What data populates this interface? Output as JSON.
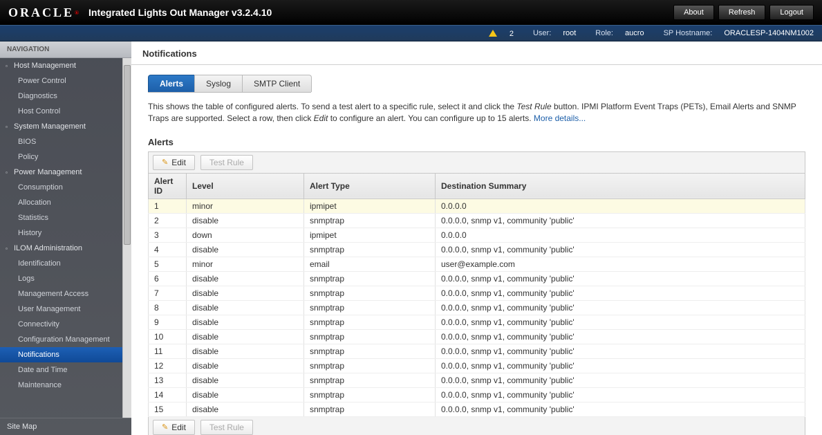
{
  "header": {
    "logo": "ORACLE",
    "title": "Integrated Lights Out Manager v3.2.4.10",
    "buttons": {
      "about": "About",
      "refresh": "Refresh",
      "logout": "Logout"
    }
  },
  "statusbar": {
    "warn_count": "2",
    "user_label": "User:",
    "user_value": "root",
    "role_label": "Role:",
    "role_value": "aucro",
    "host_label": "SP Hostname:",
    "host_value": "ORACLESP-1404NM1002"
  },
  "sidebar": {
    "head": "NAVIGATION",
    "groups": [
      {
        "label": "Host Management",
        "items": [
          "Power Control",
          "Diagnostics",
          "Host Control"
        ]
      },
      {
        "label": "System Management",
        "items": [
          "BIOS",
          "Policy"
        ]
      },
      {
        "label": "Power Management",
        "items": [
          "Consumption",
          "Allocation",
          "Statistics",
          "History"
        ]
      },
      {
        "label": "ILOM Administration",
        "items": [
          "Identification",
          "Logs",
          "Management Access",
          "User Management",
          "Connectivity",
          "Configuration Management",
          "Notifications",
          "Date and Time",
          "Maintenance"
        ]
      }
    ],
    "bottom": "Site Map",
    "active": "Notifications"
  },
  "main": {
    "title": "Notifications",
    "tabs": [
      "Alerts",
      "Syslog",
      "SMTP Client"
    ],
    "active_tab": "Alerts",
    "description_pre": "This shows the table of configured alerts. To send a test alert to a specific rule, select it and click the ",
    "description_em1": "Test Rule",
    "description_mid": " button. IPMI Platform Event Traps (PETs), Email Alerts and SNMP Traps are supported. Select a row, then click ",
    "description_em2": "Edit",
    "description_post": " to configure an alert. You can configure up to 15 alerts. ",
    "more": "More details...",
    "section": "Alerts",
    "toolbar": {
      "edit": "Edit",
      "test": "Test Rule"
    },
    "columns": {
      "id": "Alert ID",
      "level": "Level",
      "type": "Alert Type",
      "dest": "Destination Summary"
    },
    "rows": [
      {
        "id": "1",
        "level": "minor",
        "type": "ipmipet",
        "dest": "0.0.0.0"
      },
      {
        "id": "2",
        "level": "disable",
        "type": "snmptrap",
        "dest": "0.0.0.0, snmp v1, community 'public'"
      },
      {
        "id": "3",
        "level": "down",
        "type": "ipmipet",
        "dest": "0.0.0.0"
      },
      {
        "id": "4",
        "level": "disable",
        "type": "snmptrap",
        "dest": "0.0.0.0, snmp v1, community 'public'"
      },
      {
        "id": "5",
        "level": "minor",
        "type": "email",
        "dest": "user@example.com"
      },
      {
        "id": "6",
        "level": "disable",
        "type": "snmptrap",
        "dest": "0.0.0.0, snmp v1, community 'public'"
      },
      {
        "id": "7",
        "level": "disable",
        "type": "snmptrap",
        "dest": "0.0.0.0, snmp v1, community 'public'"
      },
      {
        "id": "8",
        "level": "disable",
        "type": "snmptrap",
        "dest": "0.0.0.0, snmp v1, community 'public'"
      },
      {
        "id": "9",
        "level": "disable",
        "type": "snmptrap",
        "dest": "0.0.0.0, snmp v1, community 'public'"
      },
      {
        "id": "10",
        "level": "disable",
        "type": "snmptrap",
        "dest": "0.0.0.0, snmp v1, community 'public'"
      },
      {
        "id": "11",
        "level": "disable",
        "type": "snmptrap",
        "dest": "0.0.0.0, snmp v1, community 'public'"
      },
      {
        "id": "12",
        "level": "disable",
        "type": "snmptrap",
        "dest": "0.0.0.0, snmp v1, community 'public'"
      },
      {
        "id": "13",
        "level": "disable",
        "type": "snmptrap",
        "dest": "0.0.0.0, snmp v1, community 'public'"
      },
      {
        "id": "14",
        "level": "disable",
        "type": "snmptrap",
        "dest": "0.0.0.0, snmp v1, community 'public'"
      },
      {
        "id": "15",
        "level": "disable",
        "type": "snmptrap",
        "dest": "0.0.0.0, snmp v1, community 'public'"
      }
    ]
  }
}
